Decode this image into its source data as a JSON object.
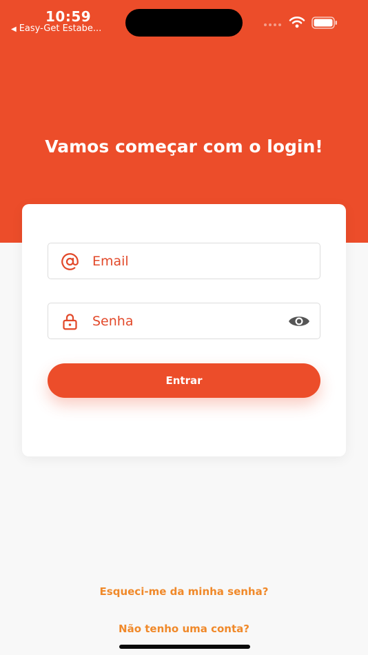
{
  "status_bar": {
    "time": "10:59",
    "back_app": "Easy-Get Estabe...",
    "icons": [
      "signal-icon",
      "wifi-icon",
      "battery-icon"
    ]
  },
  "page": {
    "title": "Vamos começar com o login!"
  },
  "form": {
    "email_placeholder": "Email",
    "password_placeholder": "Senha",
    "submit_label": "Entrar"
  },
  "links": {
    "forgot_password": "Esqueci-me da minha senha?",
    "no_account": "Não tenho uma conta?"
  },
  "colors": {
    "primary": "#ec4d2a",
    "link": "#f0892a",
    "background": "#f8f8f8",
    "card": "#ffffff"
  }
}
